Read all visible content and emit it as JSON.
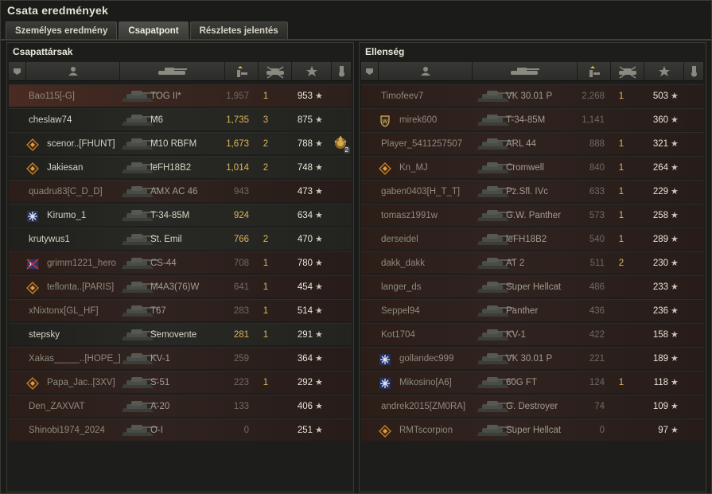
{
  "window": {
    "title": "Csata eredmények"
  },
  "tabs": [
    {
      "label": "Személyes eredmény",
      "active": false
    },
    {
      "label": "Csapatpont",
      "active": true
    },
    {
      "label": "Részletes jelentés",
      "active": false
    }
  ],
  "colors": {
    "damage": "#e0b55a",
    "accent": "#e0b55a"
  },
  "team": {
    "title": "Csapattársak",
    "rows": [
      {
        "name": "Bao115[-G]",
        "vehicle": "TOG II*",
        "damage": "1,957",
        "kills": "1",
        "xp": "953",
        "star": "★",
        "dead": "strong",
        "icon": "",
        "damage_gray": true
      },
      {
        "name": "cheslaw74",
        "vehicle": "M6",
        "damage": "1,735",
        "kills": "3",
        "xp": "875",
        "star": "★",
        "dead": "",
        "icon": "",
        "damage_gray": false
      },
      {
        "name": "scenor..[FHUNT]",
        "vehicle": "M10 RBFM",
        "damage": "1,673",
        "kills": "2",
        "xp": "788",
        "star": "★",
        "dead": "",
        "icon": "diamond-emblem-icon",
        "damage_gray": false,
        "medal": "2"
      },
      {
        "name": "Jakiesan",
        "vehicle": "leFH18B2",
        "damage": "1,014",
        "kills": "2",
        "xp": "748",
        "star": "★",
        "dead": "",
        "icon": "diamond-emblem-icon",
        "damage_gray": false
      },
      {
        "name": "quadru83[C_D_D]",
        "vehicle": "AMX AC 46",
        "damage": "943",
        "kills": "",
        "xp": "473",
        "star": "★",
        "dead": "dead",
        "icon": "",
        "damage_gray": true
      },
      {
        "name": "Kirumo_1",
        "vehicle": "T-34-85M",
        "damage": "924",
        "kills": "",
        "xp": "634",
        "star": "★",
        "dead": "",
        "icon": "snowflake-emblem-icon",
        "damage_gray": false
      },
      {
        "name": "krutywus1",
        "vehicle": "St. Emil",
        "damage": "766",
        "kills": "2",
        "xp": "470",
        "star": "★",
        "dead": "",
        "icon": "",
        "damage_gray": false
      },
      {
        "name": "grimm1221_hero",
        "vehicle": "CS-44",
        "damage": "708",
        "kills": "1",
        "xp": "780",
        "star": "★",
        "dead": "dead",
        "icon": "flag-emblem-icon",
        "damage_gray": true
      },
      {
        "name": "teflonta..[PARIS]",
        "vehicle": "M4A3(76)W",
        "damage": "641",
        "kills": "1",
        "xp": "454",
        "star": "★",
        "dead": "dead",
        "icon": "diamond-emblem-icon",
        "damage_gray": true
      },
      {
        "name": "xNixtonx[GL_HF]",
        "vehicle": "T67",
        "damage": "283",
        "kills": "1",
        "xp": "514",
        "star": "★",
        "dead": "dead",
        "icon": "",
        "damage_gray": true
      },
      {
        "name": "stepsky",
        "vehicle": "Semovente",
        "damage": "281",
        "kills": "1",
        "xp": "291",
        "star": "★",
        "dead": "",
        "icon": "",
        "damage_gray": false
      },
      {
        "name": "Xakas_____..[HOPE_]",
        "vehicle": "KV-1",
        "damage": "259",
        "kills": "",
        "xp": "364",
        "star": "★",
        "dead": "dead",
        "icon": "",
        "damage_gray": true
      },
      {
        "name": "Papa_Jac..[3XV]",
        "vehicle": "S-51",
        "damage": "223",
        "kills": "1",
        "xp": "292",
        "star": "★",
        "dead": "dead",
        "icon": "diamond-emblem-icon",
        "damage_gray": true
      },
      {
        "name": "Den_ZAXVAT",
        "vehicle": "A-20",
        "damage": "133",
        "kills": "",
        "xp": "406",
        "star": "★",
        "dead": "dead",
        "icon": "",
        "damage_gray": true
      },
      {
        "name": "Shinobi1974_2024",
        "vehicle": "O-I",
        "damage": "0",
        "kills": "",
        "xp": "251",
        "star": "★",
        "dead": "dead",
        "icon": "",
        "damage_gray": true
      }
    ]
  },
  "enemy": {
    "title": "Ellenség",
    "rows": [
      {
        "name": "Timofeev7",
        "vehicle": "VK 30.01 P",
        "damage": "2,268",
        "kills": "1",
        "xp": "503",
        "star": "★",
        "dead": "dead",
        "icon": "",
        "damage_gray": true
      },
      {
        "name": "mirek600",
        "vehicle": "T-34-85M",
        "damage": "1,141",
        "kills": "",
        "xp": "360",
        "star": "★",
        "dead": "dead",
        "icon": "shield-emblem-icon",
        "damage_gray": true
      },
      {
        "name": "Player_5411257507",
        "vehicle": "ARL 44",
        "damage": "888",
        "kills": "1",
        "xp": "321",
        "star": "★",
        "dead": "dead",
        "icon": "",
        "damage_gray": true
      },
      {
        "name": "Kn_MJ",
        "vehicle": "Cromwell",
        "damage": "840",
        "kills": "1",
        "xp": "264",
        "star": "★",
        "dead": "dead",
        "icon": "diamond-emblem-icon",
        "damage_gray": true
      },
      {
        "name": "gaben0403[H_T_T]",
        "vehicle": "Pz.Sfl. IVc",
        "damage": "633",
        "kills": "1",
        "xp": "229",
        "star": "★",
        "dead": "dead",
        "icon": "",
        "damage_gray": true
      },
      {
        "name": "tomasz1991w",
        "vehicle": "G.W. Panther",
        "damage": "573",
        "kills": "1",
        "xp": "258",
        "star": "★",
        "dead": "dead",
        "icon": "",
        "damage_gray": true
      },
      {
        "name": "derseidel",
        "vehicle": "leFH18B2",
        "damage": "540",
        "kills": "1",
        "xp": "289",
        "star": "★",
        "dead": "dead",
        "icon": "",
        "damage_gray": true
      },
      {
        "name": "dakk_dakk",
        "vehicle": "AT 2",
        "damage": "511",
        "kills": "2",
        "xp": "230",
        "star": "★",
        "dead": "dead",
        "icon": "",
        "damage_gray": true
      },
      {
        "name": "langer_ds",
        "vehicle": "Super Hellcat",
        "damage": "486",
        "kills": "",
        "xp": "233",
        "star": "★",
        "dead": "dead",
        "icon": "",
        "damage_gray": true
      },
      {
        "name": "Seppel94",
        "vehicle": "Panther",
        "damage": "436",
        "kills": "",
        "xp": "236",
        "star": "★",
        "dead": "dead",
        "icon": "",
        "damage_gray": true
      },
      {
        "name": "Kot1704",
        "vehicle": "KV-1",
        "damage": "422",
        "kills": "",
        "xp": "158",
        "star": "★",
        "dead": "dead",
        "icon": "",
        "damage_gray": true
      },
      {
        "name": "gollandec999",
        "vehicle": "VK 30.01 P",
        "damage": "221",
        "kills": "",
        "xp": "189",
        "star": "★",
        "dead": "dead",
        "icon": "snowflake-emblem-icon",
        "damage_gray": true
      },
      {
        "name": "Mikosino[A6]",
        "vehicle": "60G FT",
        "damage": "124",
        "kills": "1",
        "xp": "118",
        "star": "★",
        "dead": "dead",
        "icon": "snowflake-emblem-icon",
        "damage_gray": true
      },
      {
        "name": "andrek2015[ZM0RA]",
        "vehicle": "G. Destroyer",
        "damage": "74",
        "kills": "",
        "xp": "109",
        "star": "★",
        "dead": "dead",
        "icon": "",
        "damage_gray": true
      },
      {
        "name": "RMTscorpion",
        "vehicle": "Super Hellcat",
        "damage": "0",
        "kills": "",
        "xp": "97",
        "star": "★",
        "dead": "dead",
        "icon": "diamond-emblem-icon",
        "damage_gray": true
      }
    ]
  }
}
